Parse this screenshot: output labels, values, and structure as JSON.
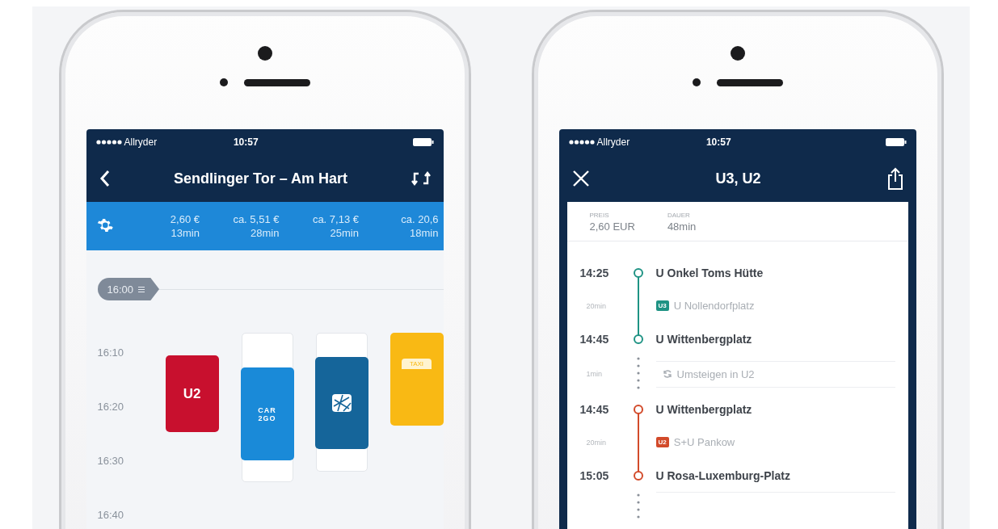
{
  "phones": [
    {
      "kind": "timeline",
      "status_bar": {
        "carrier": "Allryder",
        "time": "10:57"
      },
      "nav": {
        "title": "Sendlinger Tor – Am Hart"
      },
      "options": [
        {
          "price": "2,60 €",
          "duration": "13min"
        },
        {
          "price": "ca. 5,51 €",
          "duration": "28min"
        },
        {
          "price": "ca. 7,13 €",
          "duration": "25min"
        },
        {
          "price": "ca. 20,6",
          "duration": "18min"
        }
      ],
      "departure": "16:00",
      "times": [
        "16:10",
        "16:20",
        "16:30",
        "16:40"
      ],
      "cards": [
        {
          "kind": "line",
          "label": "U2",
          "color": "#c8102e"
        },
        {
          "kind": "logo",
          "lines": [
            "CAR",
            "2GO"
          ],
          "color": "#1a8ad8"
        },
        {
          "kind": "bike",
          "color": "#15659a"
        },
        {
          "kind": "taxi",
          "label": "TAXI",
          "color": "#f9b914"
        }
      ]
    },
    {
      "kind": "route",
      "status_bar": {
        "carrier": "Allryder",
        "time": "10:57"
      },
      "nav": {
        "title": "U3, U2"
      },
      "summary": [
        {
          "label": "PREIS",
          "value": "2,60 EUR"
        },
        {
          "label": "DAUER",
          "value": "48min"
        }
      ],
      "legs": [
        {
          "kind": "stop",
          "time": "14:25",
          "name": "U Onkel Toms Hütte",
          "color": "#1f9384"
        },
        {
          "kind": "ride",
          "duration": "20min",
          "line": "U3",
          "direction": "U Nollendorfplatz",
          "color": "#1f9384"
        },
        {
          "kind": "stop",
          "time": "14:45",
          "name": "U Wittenbergplatz",
          "color": "#1f9384"
        },
        {
          "kind": "transfer",
          "duration": "1min",
          "text": "Umsteigen in U2"
        },
        {
          "kind": "stop",
          "time": "14:45",
          "name": "U Wittenbergplatz",
          "color": "#d24a2a"
        },
        {
          "kind": "ride",
          "duration": "20min",
          "line": "U2",
          "direction": "S+U Pankow",
          "color": "#d24a2a"
        },
        {
          "kind": "stop",
          "time": "15:05",
          "name": "U Rosa-Luxemburg-Platz",
          "color": "#d24a2a"
        },
        {
          "kind": "walk"
        }
      ]
    }
  ]
}
